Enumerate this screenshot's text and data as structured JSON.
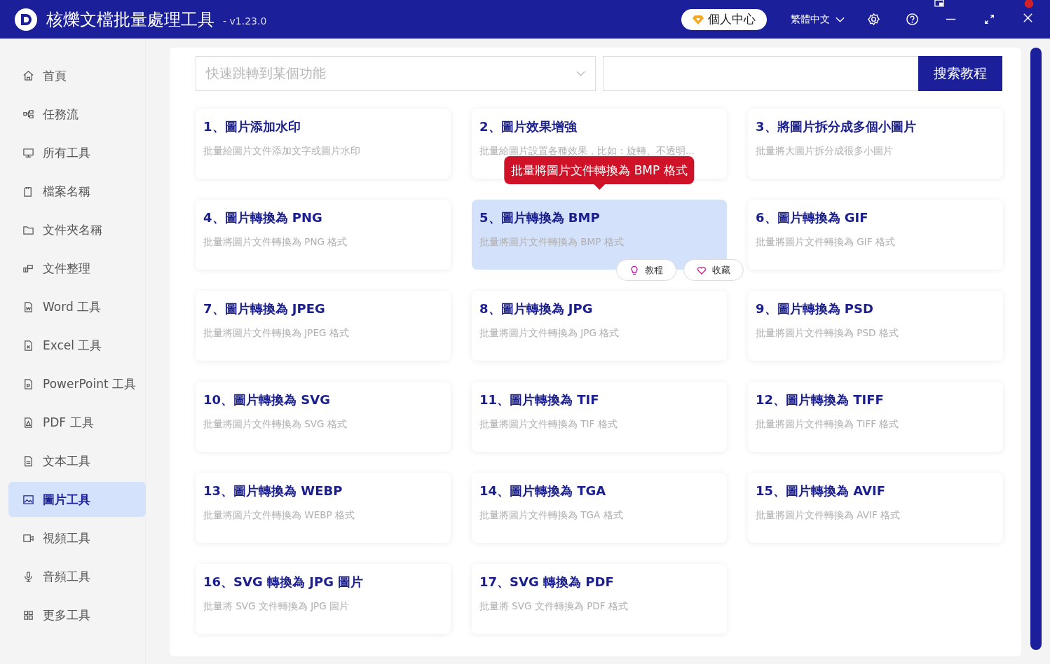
{
  "window": {
    "title": "核爍文檔批量處理工具",
    "version": "- v1.23.0"
  },
  "header": {
    "account_button": "個人中心",
    "language": "繁體中文"
  },
  "sidebar": {
    "items": [
      {
        "label": "首頁",
        "selected": false
      },
      {
        "label": "任務流",
        "selected": false
      },
      {
        "label": "所有工具",
        "selected": false
      },
      {
        "label": "檔案名稱",
        "selected": false
      },
      {
        "label": "文件夾名稱",
        "selected": false
      },
      {
        "label": "文件整理",
        "selected": false
      },
      {
        "label": "Word 工具",
        "selected": false
      },
      {
        "label": "Excel 工具",
        "selected": false
      },
      {
        "label": "PowerPoint 工具",
        "selected": false
      },
      {
        "label": "PDF 工具",
        "selected": false
      },
      {
        "label": "文本工具",
        "selected": false
      },
      {
        "label": "圖片工具",
        "selected": true
      },
      {
        "label": "視頻工具",
        "selected": false
      },
      {
        "label": "音頻工具",
        "selected": false
      },
      {
        "label": "更多工具",
        "selected": false
      }
    ]
  },
  "search": {
    "jump_placeholder": "快速跳轉到某個功能",
    "button": "搜索教程"
  },
  "tools": [
    {
      "title": "1、圖片添加水印",
      "description": "批量給圖片文件添加文字或圖片水印",
      "selected": false
    },
    {
      "title": "2、圖片效果增強",
      "description": "批量給圖片設置各種效果，比如：旋轉、不透明...",
      "selected": false
    },
    {
      "title": "3、將圖片拆分成多個小圖片",
      "description": "批量將大圖片拆分成很多小圖片",
      "selected": false
    },
    {
      "title": "4、圖片轉換為 PNG",
      "description": "批量將圖片文件轉換為 PNG 格式",
      "selected": false
    },
    {
      "title": "5、圖片轉換為 BMP",
      "description": "批量將圖片文件轉換為 BMP 格式",
      "selected": true,
      "actions": [
        "教程",
        "收藏"
      ]
    },
    {
      "title": "6、圖片轉換為 GIF",
      "description": "批量將圖片文件轉換為 GIF 格式",
      "selected": false
    },
    {
      "title": "7、圖片轉換為 JPEG",
      "description": "批量將圖片文件轉換為 JPEG 格式",
      "selected": false
    },
    {
      "title": "8、圖片轉換為 JPG",
      "description": "批量將圖片文件轉換為 JPG 格式",
      "selected": false
    },
    {
      "title": "9、圖片轉換為 PSD",
      "description": "批量將圖片文件轉換為 PSD 格式",
      "selected": false
    },
    {
      "title": "10、圖片轉換為 SVG",
      "description": "批量將圖片文件轉換為 SVG 格式",
      "selected": false
    },
    {
      "title": "11、圖片轉換為 TIF",
      "description": "批量將圖片文件轉換為 TIF 格式",
      "selected": false
    },
    {
      "title": "12、圖片轉換為 TIFF",
      "description": "批量將圖片文件轉換為 TIFF 格式",
      "selected": false
    },
    {
      "title": "13、圖片轉換為 WEBP",
      "description": "批量將圖片文件轉換為 WEBP 格式",
      "selected": false
    },
    {
      "title": "14、圖片轉換為 TGA",
      "description": "批量將圖片文件轉換為 TGA 格式",
      "selected": false
    },
    {
      "title": "15、圖片轉換為 AVIF",
      "description": "批量將圖片文件轉換為 AVIF 格式",
      "selected": false
    },
    {
      "title": "16、SVG 轉換為 JPG 圖片",
      "description": "批量將 SVG 文件轉換為 JPG 圖片",
      "selected": false
    },
    {
      "title": "17、SVG 轉換為 PDF",
      "description": "批量將 SVG 文件轉換為 PDF 格式",
      "selected": false
    }
  ],
  "hover_tooltip": {
    "text": "批量將圖片文件轉換為 BMP 格式"
  }
}
